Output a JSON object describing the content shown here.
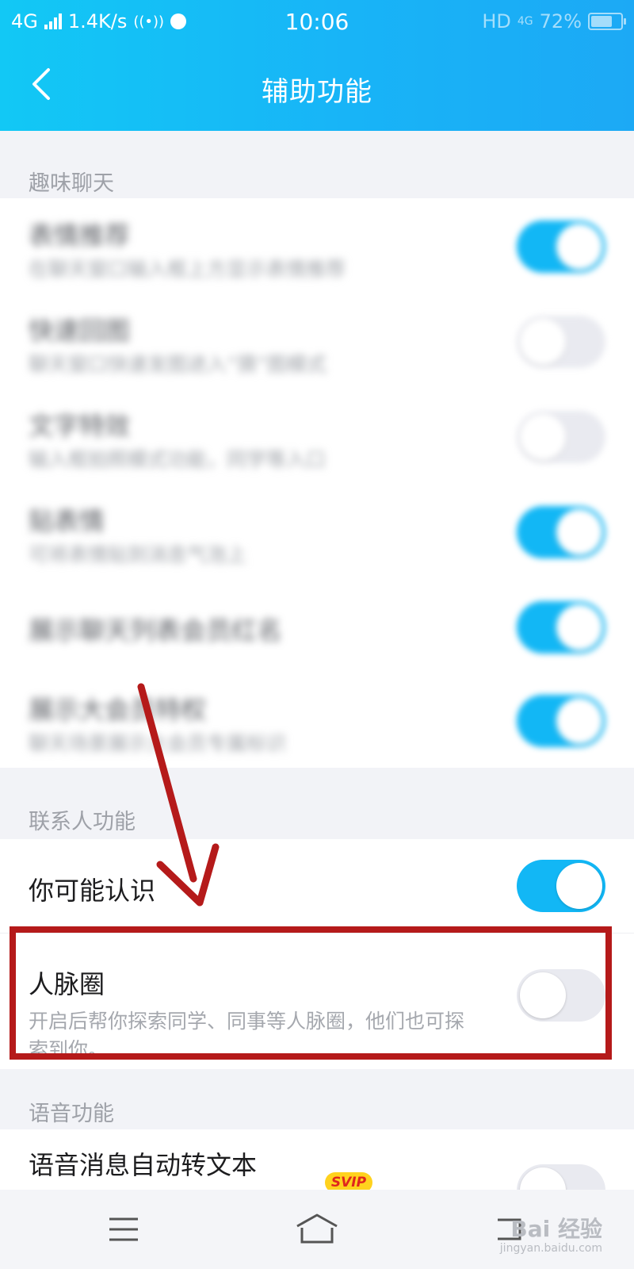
{
  "status_bar": {
    "network": "4G",
    "speed": "1.4K/s",
    "time": "10:06",
    "hd": "HD",
    "network_right": "4G",
    "battery": "72%"
  },
  "header": {
    "title": "辅助功能",
    "back_icon": "chevron-left-icon"
  },
  "sections": {
    "fun_chat": {
      "header": "趣味聊天",
      "rows": [
        {
          "title": "表情推荐",
          "desc": "在聊天窗口输入框上方显示表情推荐",
          "on": true
        },
        {
          "title": "快速回图",
          "desc": "聊天窗口快速发图进入“猜”图模式",
          "on": false
        },
        {
          "title": "文字特效",
          "desc": "输入框拍照模式功能，同学等入口",
          "on": false
        },
        {
          "title": "贴表情",
          "desc": "可将表情贴到消息气泡上",
          "on": true
        },
        {
          "title": "展示聊天列表会员红名",
          "desc": "",
          "on": true
        },
        {
          "title": "展示大会员特权",
          "desc": "聊天场景展示大会员专属标识",
          "on": true
        }
      ]
    },
    "contacts": {
      "header": "联系人功能",
      "rows": [
        {
          "title": "你可能认识",
          "desc": "",
          "on": true
        },
        {
          "title": "人脉圈",
          "desc": "开启后帮你探索同学、同事等人脉圈，他们也可探索到你。",
          "on": false
        }
      ]
    },
    "voice": {
      "header": "语音功能",
      "rows": [
        {
          "title": "语音消息自动转文本",
          "badge": "SVIP",
          "on": false
        }
      ]
    }
  },
  "nav": {
    "menu_icon": "menu-icon",
    "home_icon": "home-icon",
    "back_icon": "back-icon"
  },
  "watermark": {
    "text": "Bai 经验",
    "sub": "jingyan.baidu.com"
  },
  "colors": {
    "accent": "#12b7f5",
    "annotation": "#b51a1a",
    "badge": "#ffd21e"
  }
}
